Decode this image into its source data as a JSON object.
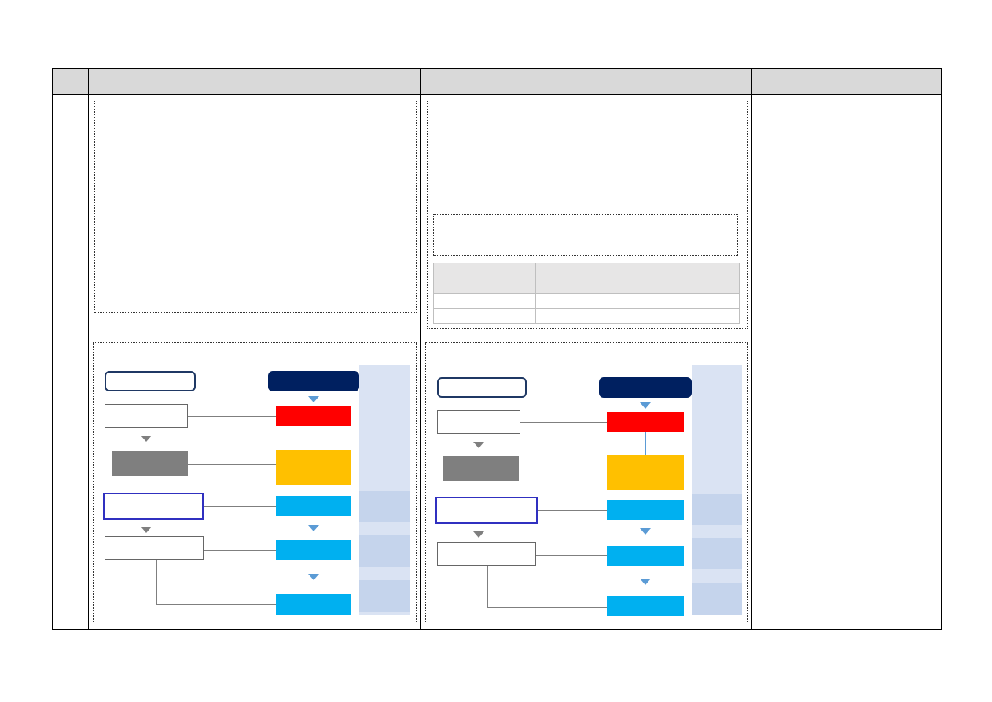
{
  "table": {
    "columns": 4,
    "rows": 3
  }
}
